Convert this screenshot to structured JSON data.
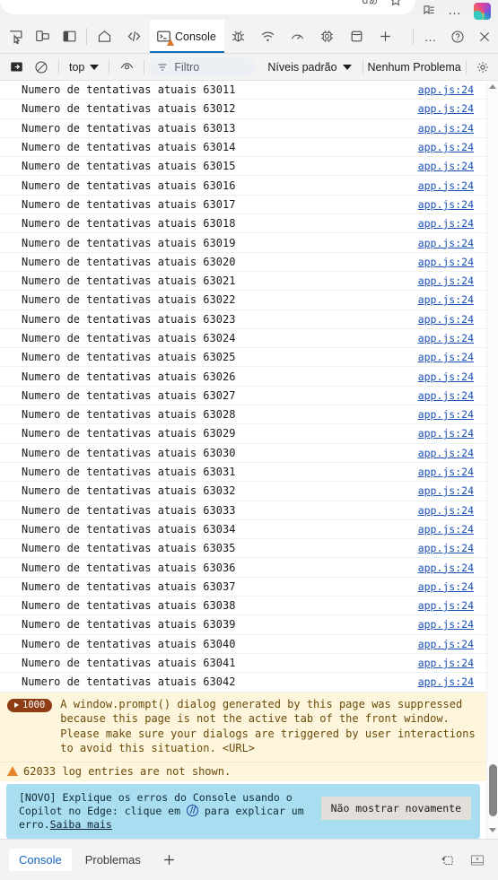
{
  "browser": {
    "ime_indicator": "ｄあ",
    "star_icon": "favorites-star-icon",
    "collections_icon": "collections-icon",
    "more_icon": "…",
    "copilot_icon": "copilot-logo"
  },
  "devtools_tabbar": {
    "icons": [
      {
        "name": "inspect-element-icon",
        "title": "Inspecionar"
      },
      {
        "name": "device-emulation-icon",
        "title": "Emulação de dispositivo"
      },
      {
        "name": "dock-side-icon",
        "title": "Encaixar"
      }
    ],
    "tabs": [
      {
        "name": "tab-welcome",
        "label": "",
        "icon": "home-icon",
        "active": false
      },
      {
        "name": "tab-elements",
        "label": "",
        "icon": "code-icon",
        "active": false
      },
      {
        "name": "tab-console",
        "label": "Console",
        "icon": "console-icon",
        "active": true,
        "badge": "warning"
      },
      {
        "name": "tab-sources",
        "label": "",
        "icon": "bug-icon",
        "active": false
      },
      {
        "name": "tab-network",
        "label": "",
        "icon": "network-icon",
        "active": false
      },
      {
        "name": "tab-performance",
        "label": "",
        "icon": "performance-icon",
        "active": false
      },
      {
        "name": "tab-application",
        "label": "",
        "icon": "gear-chip-icon",
        "active": false
      },
      {
        "name": "tab-memory",
        "label": "",
        "icon": "database-icon",
        "active": false
      }
    ],
    "add_tab_label": "+",
    "more_tools_label": "…",
    "help_label": "?",
    "close_label": "×"
  },
  "console_toolbar": {
    "sidebar_toggle": "console-sidebar-icon",
    "clear_console": "clear-console-icon",
    "context_selector": "top",
    "live_expression": "eye-icon",
    "filter_placeholder": "Filtro",
    "filter_value": "",
    "levels_label": "Níveis padrão",
    "issues_label": "Nenhum Problema",
    "settings_icon": "gear-icon"
  },
  "console": {
    "log_prefix": "Numero de tentativas atuais",
    "source_label": "app.js:24",
    "entries": [
      {
        "text": "Numero de tentativas atuais 63011",
        "source": "app.js:24"
      },
      {
        "text": "Numero de tentativas atuais 63012",
        "source": "app.js:24"
      },
      {
        "text": "Numero de tentativas atuais 63013",
        "source": "app.js:24"
      },
      {
        "text": "Numero de tentativas atuais 63014",
        "source": "app.js:24"
      },
      {
        "text": "Numero de tentativas atuais 63015",
        "source": "app.js:24"
      },
      {
        "text": "Numero de tentativas atuais 63016",
        "source": "app.js:24"
      },
      {
        "text": "Numero de tentativas atuais 63017",
        "source": "app.js:24"
      },
      {
        "text": "Numero de tentativas atuais 63018",
        "source": "app.js:24"
      },
      {
        "text": "Numero de tentativas atuais 63019",
        "source": "app.js:24"
      },
      {
        "text": "Numero de tentativas atuais 63020",
        "source": "app.js:24"
      },
      {
        "text": "Numero de tentativas atuais 63021",
        "source": "app.js:24"
      },
      {
        "text": "Numero de tentativas atuais 63022",
        "source": "app.js:24"
      },
      {
        "text": "Numero de tentativas atuais 63023",
        "source": "app.js:24"
      },
      {
        "text": "Numero de tentativas atuais 63024",
        "source": "app.js:24"
      },
      {
        "text": "Numero de tentativas atuais 63025",
        "source": "app.js:24"
      },
      {
        "text": "Numero de tentativas atuais 63026",
        "source": "app.js:24"
      },
      {
        "text": "Numero de tentativas atuais 63027",
        "source": "app.js:24"
      },
      {
        "text": "Numero de tentativas atuais 63028",
        "source": "app.js:24"
      },
      {
        "text": "Numero de tentativas atuais 63029",
        "source": "app.js:24"
      },
      {
        "text": "Numero de tentativas atuais 63030",
        "source": "app.js:24"
      },
      {
        "text": "Numero de tentativas atuais 63031",
        "source": "app.js:24"
      },
      {
        "text": "Numero de tentativas atuais 63032",
        "source": "app.js:24"
      },
      {
        "text": "Numero de tentativas atuais 63033",
        "source": "app.js:24"
      },
      {
        "text": "Numero de tentativas atuais 63034",
        "source": "app.js:24"
      },
      {
        "text": "Numero de tentativas atuais 63035",
        "source": "app.js:24"
      },
      {
        "text": "Numero de tentativas atuais 63036",
        "source": "app.js:24"
      },
      {
        "text": "Numero de tentativas atuais 63037",
        "source": "app.js:24"
      },
      {
        "text": "Numero de tentativas atuais 63038",
        "source": "app.js:24"
      },
      {
        "text": "Numero de tentativas atuais 63039",
        "source": "app.js:24"
      },
      {
        "text": "Numero de tentativas atuais 63040",
        "source": "app.js:24"
      },
      {
        "text": "Numero de tentativas atuais 63041",
        "source": "app.js:24"
      },
      {
        "text": "Numero de tentativas atuais 63042",
        "source": "app.js:24"
      }
    ],
    "grouped_warning": {
      "count": "1000",
      "message": "A window.prompt() dialog generated by this page was suppressed\nbecause this page is not the active tab of the front window.\nPlease make sure your dialogs are triggered by user interactions\nto avoid this situation. <URL>"
    },
    "not_shown_notice": "62033 log entries are not shown.",
    "prompt_caret": "❯"
  },
  "copilot_banner": {
    "text_part1": "[NOVO] Explique os erros do Console usando o Copilot no Edge: clique em ",
    "icon": "copilot-inline-icon",
    "text_part2": " para explicar um erro.",
    "link_label": "Saiba mais",
    "dismiss_label": "Não mostrar novamente",
    "background": "#a8def0"
  },
  "drawer_tabbar": {
    "tabs": [
      {
        "name": "drawer-tab-console",
        "label": "Console",
        "active": true
      },
      {
        "name": "drawer-tab-problemas",
        "label": "Problemas",
        "active": false
      }
    ],
    "add_label": "+",
    "right_icons": [
      {
        "name": "restore-drawer-icon"
      },
      {
        "name": "dock-drawer-icon"
      }
    ]
  },
  "colors": {
    "accent": "#0f6cbd",
    "warning_bg": "#fdf6dd",
    "warning_text": "#6b4a08",
    "link": "#1a4fb3",
    "pill": "#8f3d14"
  }
}
